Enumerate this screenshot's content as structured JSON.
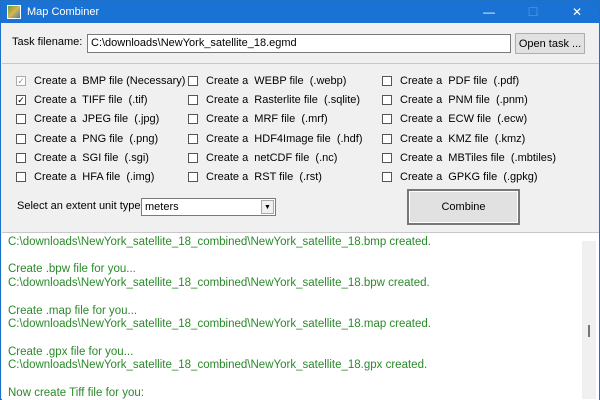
{
  "window": {
    "title": "Map Combiner",
    "minimize": "—",
    "maximize": "☐",
    "close": "✕"
  },
  "task": {
    "label": "Task filename:",
    "value": "C:\\downloads\\NewYork_satellite_18.egmd",
    "open_button": "Open task ..."
  },
  "options": [
    [
      {
        "label": "Create a  BMP file (Necessary)",
        "checked": true,
        "disabled": true
      },
      {
        "label": "Create a  TIFF file  (.tif)",
        "checked": true
      },
      {
        "label": "Create a  JPEG file  (.jpg)",
        "checked": false
      },
      {
        "label": "Create a  PNG file  (.png)",
        "checked": false
      },
      {
        "label": "Create a  SGI file  (.sgi)",
        "checked": false
      },
      {
        "label": "Create a  HFA file  (.img)",
        "checked": false
      }
    ],
    [
      {
        "label": "Create a  WEBP file  (.webp)",
        "checked": false
      },
      {
        "label": "Create a  Rasterlite file  (.sqlite)",
        "checked": false
      },
      {
        "label": "Create a  MRF file  (.mrf)",
        "checked": false
      },
      {
        "label": "Create a  HDF4Image file  (.hdf)",
        "checked": false
      },
      {
        "label": "Create a  netCDF file  (.nc)",
        "checked": false
      },
      {
        "label": "Create a  RST file  (.rst)",
        "checked": false
      }
    ],
    [
      {
        "label": "Create a  PDF file  (.pdf)",
        "checked": false
      },
      {
        "label": "Create a  PNM file  (.pnm)",
        "checked": false
      },
      {
        "label": "Create a  ECW file  (.ecw)",
        "checked": false
      },
      {
        "label": "Create a  KMZ file  (.kmz)",
        "checked": false
      },
      {
        "label": "Create a  MBTiles file  (.mbtiles)",
        "checked": false
      },
      {
        "label": "Create a  GPKG file  (.gpkg)",
        "checked": false
      }
    ]
  ],
  "unit": {
    "label": "Select an extent unit type:",
    "value": "meters"
  },
  "combine_button": "Combine",
  "log": "C:\\downloads\\NewYork_satellite_18_combined\\NewYork_satellite_18.bmp created.\n\nCreate .bpw file for you...\nC:\\downloads\\NewYork_satellite_18_combined\\NewYork_satellite_18.bpw created.\n\nCreate .map file for you...\nC:\\downloads\\NewYork_satellite_18_combined\\NewYork_satellite_18.map created.\n\nCreate .gpx file for you...\nC:\\downloads\\NewYork_satellite_18_combined\\NewYork_satellite_18.gpx created.\n\nNow create Tiff file for you:"
}
